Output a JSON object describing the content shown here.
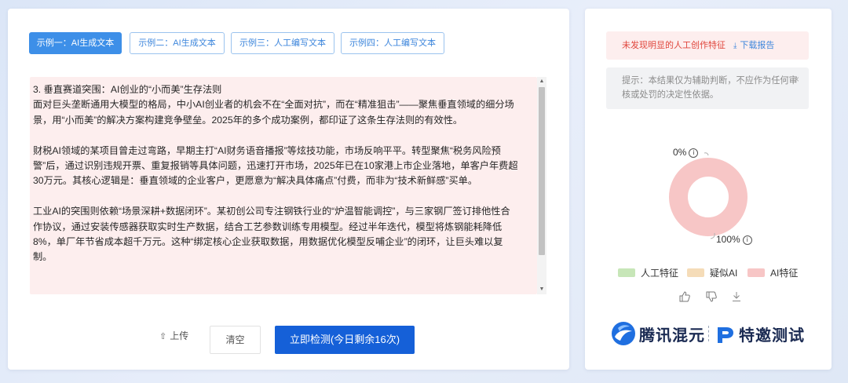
{
  "tabs": [
    {
      "label": "示例一：AI生成文本",
      "active": true
    },
    {
      "label": "示例二：AI生成文本",
      "active": false
    },
    {
      "label": "示例三：人工编写文本",
      "active": false
    },
    {
      "label": "示例四：人工编写文本",
      "active": false
    }
  ],
  "editor": {
    "paragraphs": [
      "3. 垂直赛道突围：AI创业的“小而美”生存法则",
      "面对巨头垄断通用大模型的格局，中小AI创业者的机会不在“全面对抗”，而在“精准狙击”——聚焦垂直领域的细分场景，用“小而美”的解决方案构建竞争壁垒。2025年的多个成功案例，都印证了这条生存法则的有效性。",
      "财税AI领域的某项目曾走过弯路，早期主打“AI财务语音播报”等炫技功能，市场反响平平。转型聚焦“税务风险预警”后，通过识别违规开票、重复报销等具体问题，迅速打开市场，2025年已在10家港上市企业落地，单客户年费超30万元。其核心逻辑是：垂直领域的企业客户，更愿意为“解决具体痛点”付费，而非为“技术新鲜感”买单。",
      "工业AI的突围则依赖“场景深耕+数据闭环”。某初创公司专注钢铁行业的“炉温智能调控”，与三家钢厂签订排他性合作协议，通过安装传感器获取实时生产数据，结合工艺参数训练专用模型。经过半年迭代，模型将炼钢能耗降低8%，单厂年节省成本超千万元。这种“绑定核心企业获取数据，用数据优化模型反哺企业”的闭环，让巨头难以复制。"
    ]
  },
  "actions": {
    "upload_label": "上传",
    "clear_label": "清空",
    "detect_label": "立即检测(今日剩余16次)"
  },
  "result": {
    "warning": "未发现明显的人工创作特征",
    "download_label": "下载报告",
    "tip": "提示：本结果仅为辅助判断，不应作为任何审核或处罚的决定性依据。",
    "close_glyph": "×",
    "pct_top": "0%",
    "pct_bottom": "100%",
    "info_glyph": "i",
    "ai_fraction": 1.0,
    "legend": [
      {
        "label": "人工特征",
        "color": "#c7e6b8"
      },
      {
        "label": "疑似AI",
        "color": "#f5dcb8"
      },
      {
        "label": "AI特征",
        "color": "#f7c6c6"
      }
    ],
    "feedback_icons": [
      "thumbs-up-icon",
      "thumbs-down-icon",
      "download-icon"
    ]
  },
  "branding": {
    "hunyuan": "腾讯混元",
    "special": "特邀测试"
  },
  "colors": {
    "primary": "#1560d8",
    "tab_active": "#3d8fe8",
    "warning": "#e0463c",
    "editor_bg": "#fdeeee",
    "donut": "#f7c6c6"
  }
}
